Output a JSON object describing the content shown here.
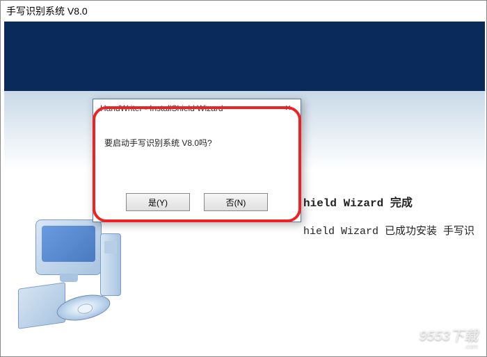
{
  "window": {
    "title": "手写识别系统 V8.0"
  },
  "wizard": {
    "heading_suffix": "hield Wizard 完成",
    "body_suffix": "hield Wizard 已成功安装 手写识"
  },
  "dialog": {
    "title": "HandWriter - InstallShield Wizard",
    "message": "要启动手写识别系统 V8.0吗?",
    "yes_label": "是(Y)",
    "no_label": "否(N)",
    "close_glyph": "×"
  },
  "watermark": {
    "text": "9553下载",
    "sub": ".com"
  }
}
